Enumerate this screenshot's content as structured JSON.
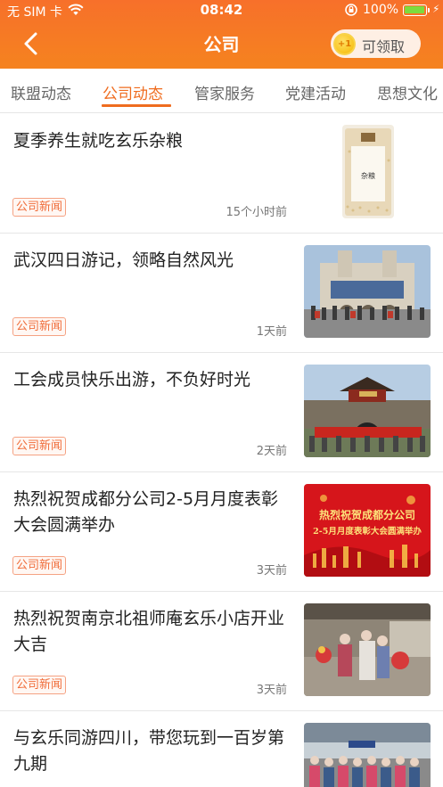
{
  "status_bar": {
    "carrier": "无 SIM 卡",
    "time": "08:42",
    "battery": "100%"
  },
  "header": {
    "title": "公司",
    "claim_label": "可领取",
    "coin_text": "+1"
  },
  "tabs": [
    {
      "label": "联盟动态",
      "active": false
    },
    {
      "label": "公司动态",
      "active": true
    },
    {
      "label": "管家服务",
      "active": false
    },
    {
      "label": "党建活动",
      "active": false
    },
    {
      "label": "思想文化",
      "active": false
    }
  ],
  "articles": [
    {
      "title": "夏季养生就吃玄乐杂粮",
      "tag": "公司新闻",
      "time": "15个小时前",
      "image": "grain-package-photo"
    },
    {
      "title": "武汉四日游记，领略自然风光",
      "tag": "公司新闻",
      "time": "1天前",
      "image": "wuhan-station-group-photo"
    },
    {
      "title": "工会成员快乐出游，不负好时光",
      "tag": "公司新闻",
      "time": "2天前",
      "image": "city-gate-group-photo"
    },
    {
      "title": "热烈祝贺成都分公司2-5月月度表彰大会圆满举办",
      "tag": "公司新闻",
      "time": "3天前",
      "image": "red-banner-poster",
      "banner_line1": "热烈祝贺成都分公司",
      "banner_line2": "2-5月月度表彰大会圆满举办"
    },
    {
      "title": "热烈祝贺南京北祖师庵玄乐小店开业大吉",
      "tag": "公司新闻",
      "time": "3天前",
      "image": "store-opening-photo"
    },
    {
      "title": "与玄乐同游四川，带您玩到一百岁第九期",
      "tag": "",
      "time": "",
      "image": "sichuan-tour-group-photo"
    }
  ],
  "colors": {
    "brand_orange": "#f5831f",
    "tab_active": "#ef6c1f",
    "tag_text": "#f06d3a"
  }
}
